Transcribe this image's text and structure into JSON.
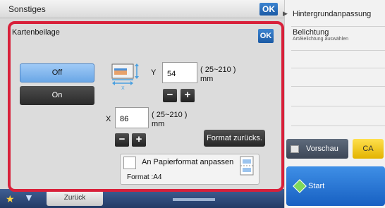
{
  "background": {
    "title": "Sonstiges",
    "ok_label": "OK",
    "back_label": "Zurück"
  },
  "side_panel": {
    "items": [
      {
        "label": "Hintergrundanpassung"
      },
      {
        "label": "Belichtung",
        "sub": "Art/Belichtung auswählen"
      }
    ],
    "preview_label": "Vorschau",
    "ca_label": "CA",
    "start_label": "Start"
  },
  "dialog": {
    "title": "Kartenbeilage",
    "ok_label": "OK",
    "off_label": "Off",
    "on_label": "On",
    "selected": "Off",
    "y": {
      "label": "Y",
      "value": "54",
      "range": "( 25~210 )",
      "unit": "mm"
    },
    "x": {
      "label": "X",
      "value": "86",
      "range": "( 25~210 )",
      "unit": "mm"
    },
    "minus_label": "−",
    "plus_label": "+",
    "reset_label": "Format zurücks.",
    "fit_label": "An Papierformat anpassen",
    "format_text": "Format    :A4",
    "fit_checked": false
  },
  "colors": {
    "dialog_border": "#d8203a",
    "ok_blue": "#1b5aa5",
    "start_blue": "#1760c2",
    "ca_yellow": "#e3b300"
  }
}
